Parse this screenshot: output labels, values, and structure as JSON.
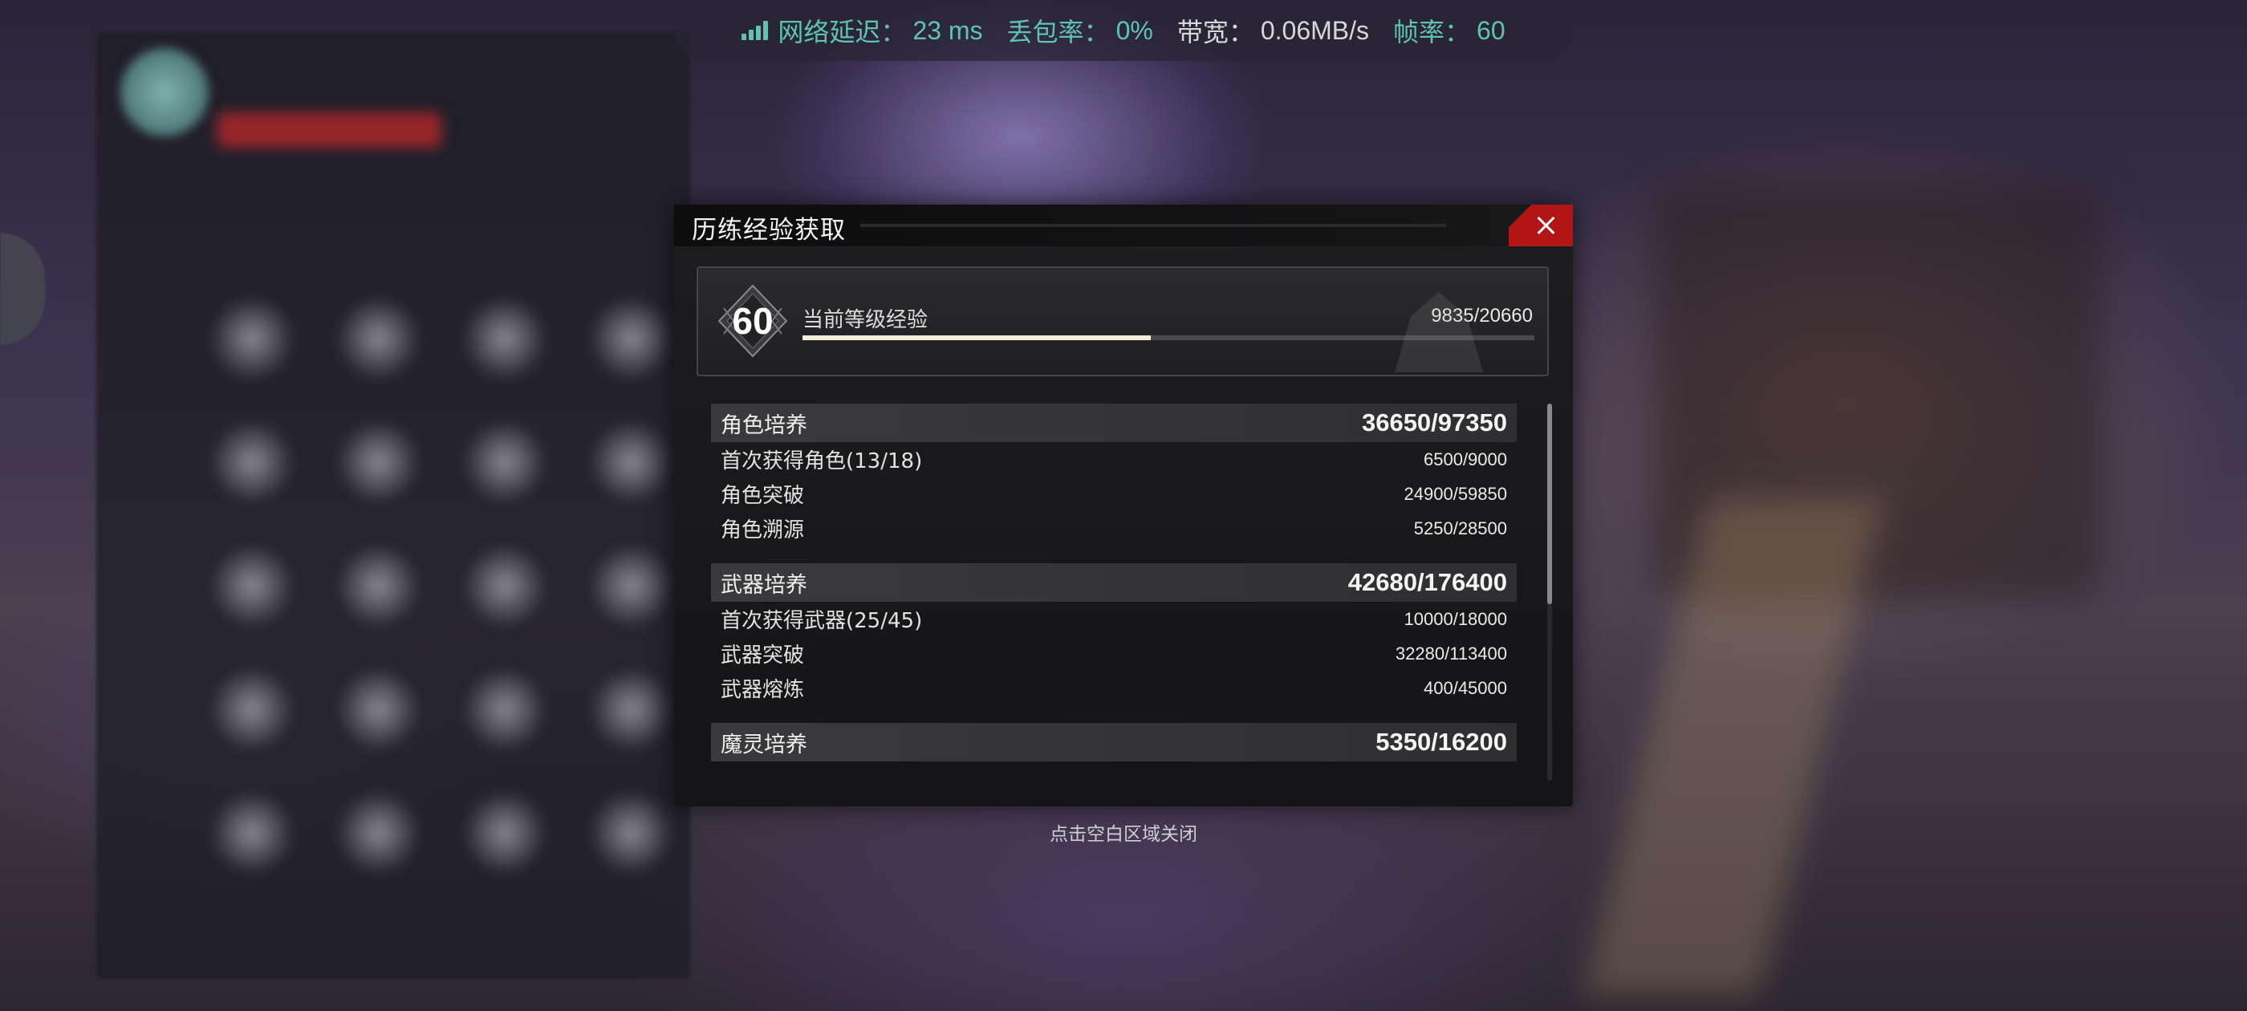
{
  "status_bar": {
    "latency_label": "网络延迟：",
    "latency_value": "23 ms",
    "loss_label": "丢包率：",
    "loss_value": "0%",
    "bandwidth_label": "带宽：",
    "bandwidth_value": "0.06MB/s",
    "fps_label": "帧率：",
    "fps_value": "60",
    "accent_color": "#5fc4ae"
  },
  "dialog": {
    "title": "历练经验获取",
    "close_icon": "close-icon",
    "close_color": "#b31414",
    "level": {
      "number": "60",
      "label": "当前等级经验",
      "value": "9835/20660",
      "progress_fraction": 0.476
    },
    "categories": [
      {
        "name": "角色培养",
        "value": "36650/97350",
        "items": [
          {
            "name": "首次获得角色(13/18)",
            "value": "6500/9000"
          },
          {
            "name": "角色突破",
            "value": "24900/59850"
          },
          {
            "name": "角色溯源",
            "value": "5250/28500"
          }
        ]
      },
      {
        "name": "武器培养",
        "value": "42680/176400",
        "items": [
          {
            "name": "首次获得武器(25/45)",
            "value": "10000/18000"
          },
          {
            "name": "武器突破",
            "value": "32280/113400"
          },
          {
            "name": "武器熔炼",
            "value": "400/45000"
          }
        ]
      },
      {
        "name": "魔灵培养",
        "value": "5350/16200",
        "items": []
      }
    ]
  },
  "hint": "点击空白区域关闭"
}
